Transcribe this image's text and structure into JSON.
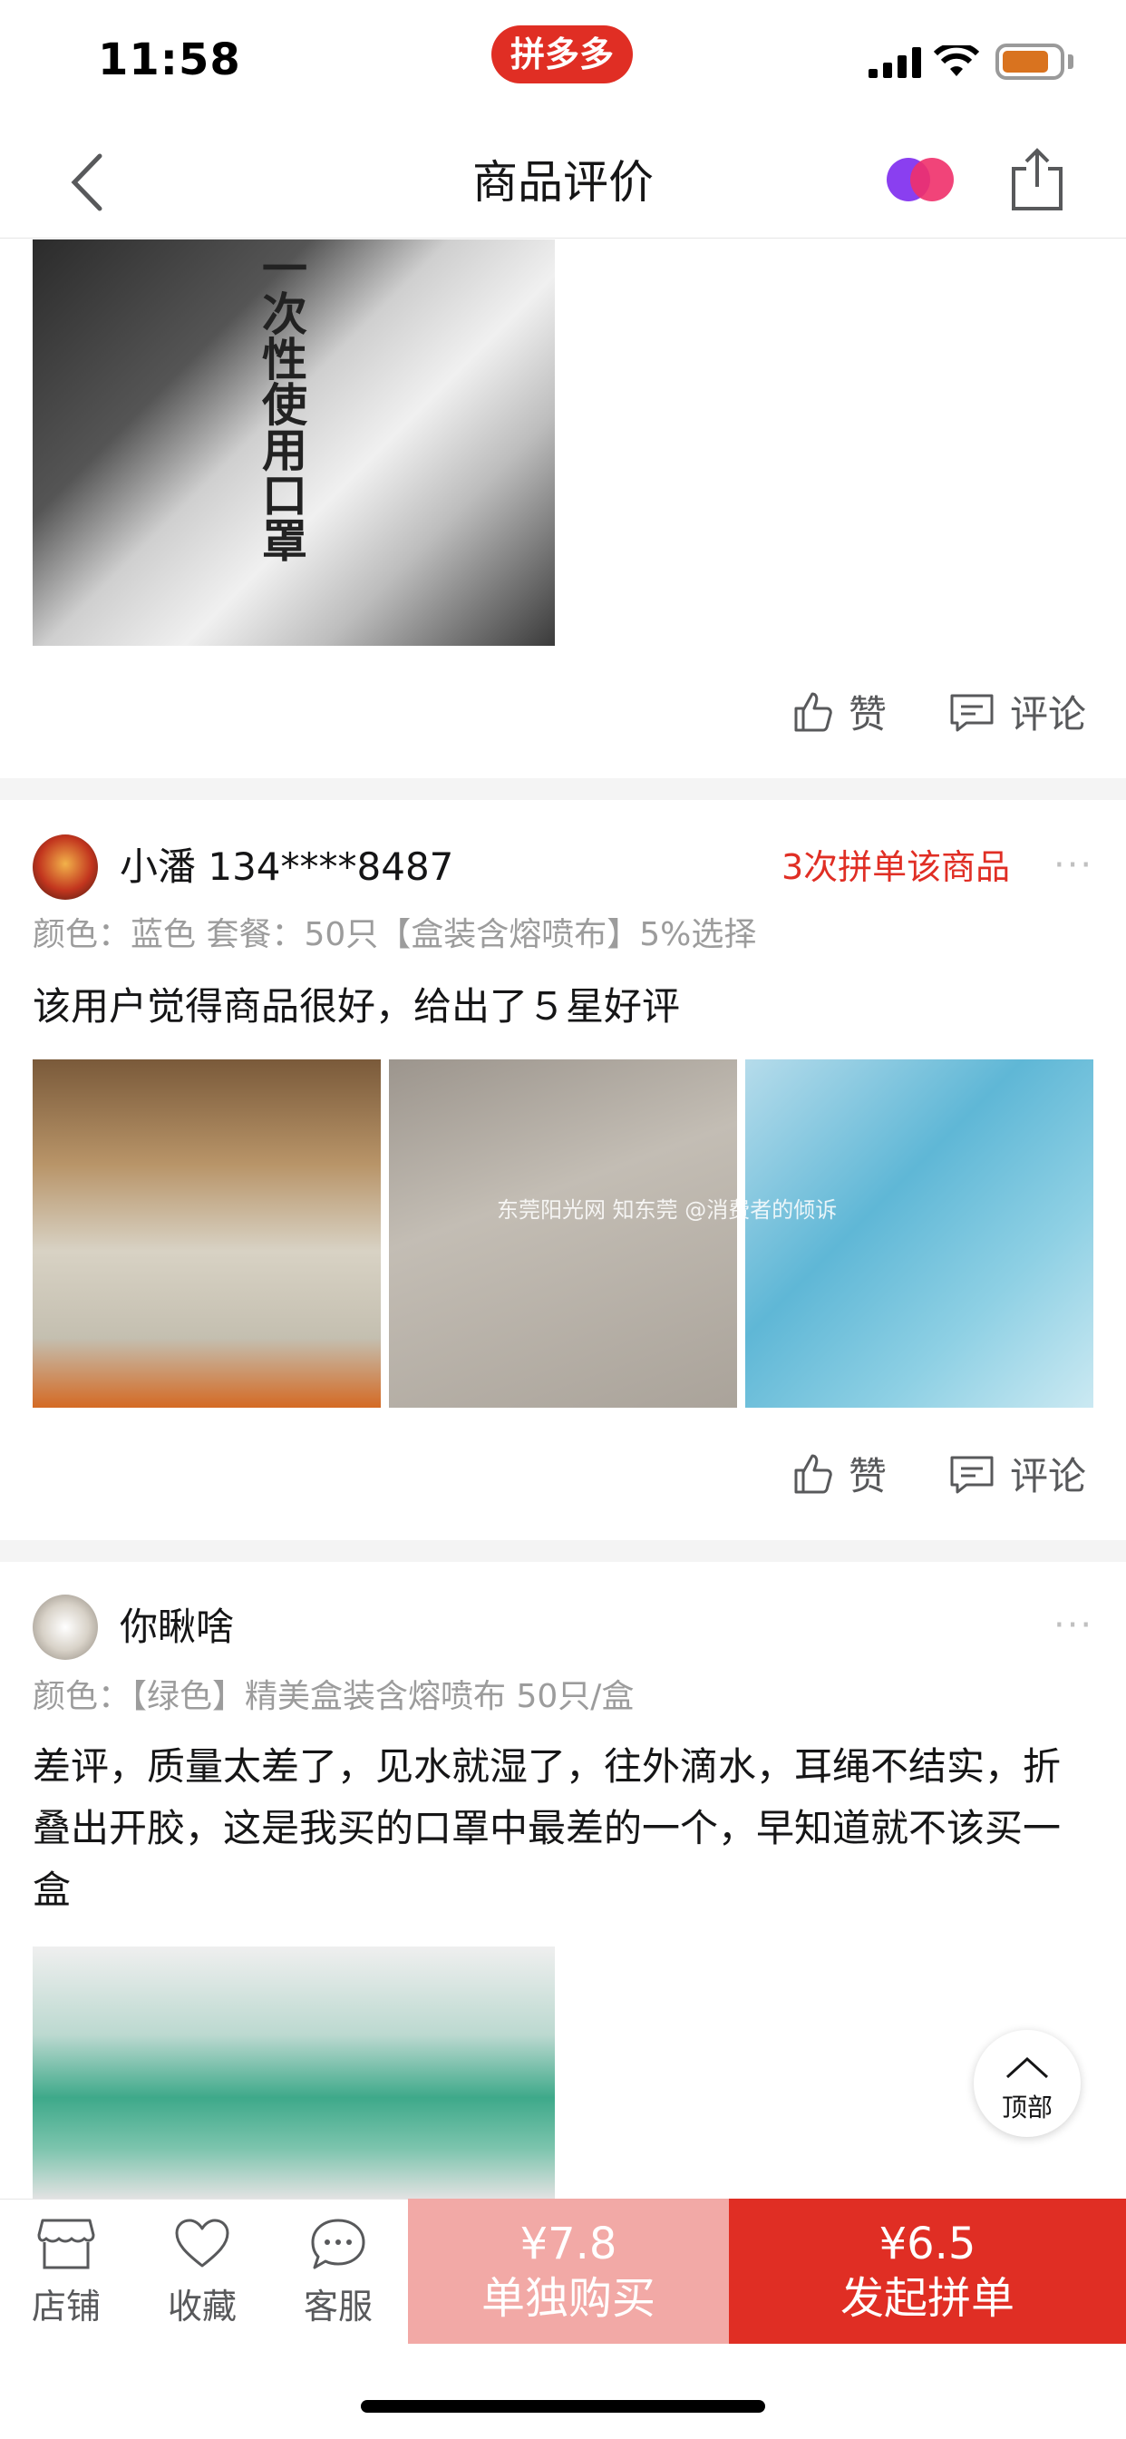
{
  "status_bar": {
    "time": "11:58",
    "app_badge": "拼多多"
  },
  "nav": {
    "title": "商品评价"
  },
  "review1": {
    "image_text": "一次性使用口罩",
    "like_label": "赞",
    "comment_label": "评论"
  },
  "review2": {
    "username": "小潘 134****8487",
    "purchase_badge": "3次拼单该商品",
    "more": "···",
    "spec": "颜色：蓝色   套餐：50只【盒装含熔喷布】5%选择",
    "text": "该用户觉得商品很好，给出了５星好评",
    "watermark": "东莞阳光网 知东莞 @消费者的倾诉",
    "like_label": "赞",
    "comment_label": "评论"
  },
  "review3": {
    "username": "你瞅啥",
    "more": "···",
    "spec": "颜色：【绿色】精美盒装含熔喷布 50只/盒",
    "text": "差评，质量太差了，见水就湿了，往外滴水，耳绳不结实，折叠出开胶，这是我买的口罩中最差的一个，早知道就不该买一盒"
  },
  "to_top": {
    "label": "顶部"
  },
  "bottom_bar": {
    "shop": "店铺",
    "favorite": "收藏",
    "service": "客服",
    "single_price": "¥7.8",
    "single_label": "单独购买",
    "group_price": "¥6.5",
    "group_label": "发起拼单"
  },
  "colors": {
    "brand_red": "#e02e24",
    "single_buy_pink": "#f2a9a6",
    "grey_text": "#9c9c9c"
  }
}
